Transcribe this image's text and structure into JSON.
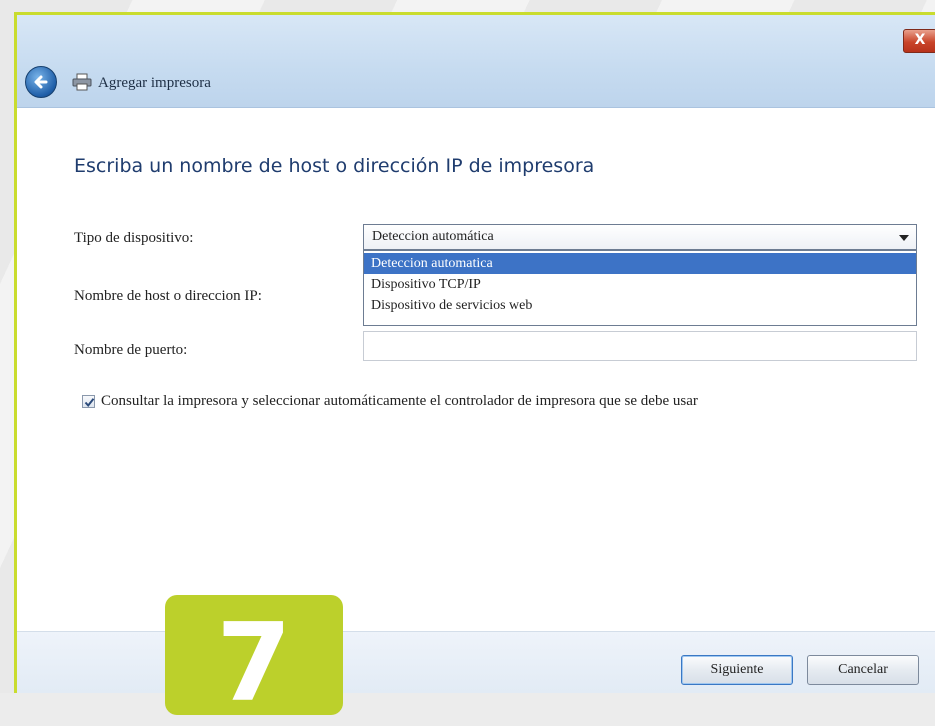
{
  "window": {
    "title": "Agregar impresora",
    "close_label": "X"
  },
  "page": {
    "heading": "Escriba un nombre de host o dirección IP de impresora"
  },
  "form": {
    "device_type_label": "Tipo de dispositivo:",
    "device_type_value": "Deteccion automática",
    "device_type_options": [
      "Deteccion automatica",
      "Dispositivo TCP/IP",
      "Dispositivo de servicios web"
    ],
    "host_label": "Nombre de host o direccion IP:",
    "port_label": "Nombre de puerto:",
    "port_value": "",
    "auto_driver_label": "Consultar la impresora y seleccionar automáticamente el controlador de impresora que se debe usar",
    "auto_driver_checked": true
  },
  "buttons": {
    "next": "Siguiente",
    "cancel": "Cancelar"
  },
  "step_badge": "7",
  "icons": [
    "back-arrow-icon",
    "printer-icon",
    "close-icon",
    "chevron-down-icon",
    "checkmark-icon"
  ],
  "colors": {
    "accent_border": "#c9dc2e",
    "badge": "#bcd02b",
    "selection": "#3d73c6",
    "heading": "#1f3c6e"
  }
}
